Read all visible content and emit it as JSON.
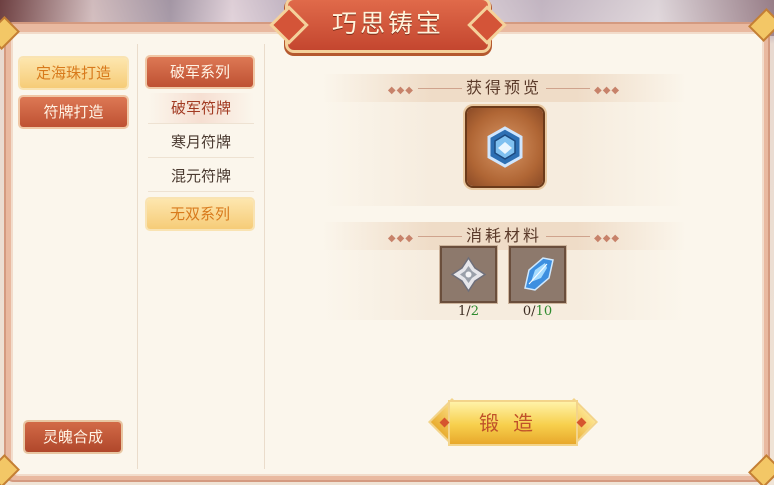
{
  "title": "巧思铸宝",
  "left_tabs": [
    {
      "label": "定海珠打造",
      "active": true
    },
    {
      "label": "符牌打造",
      "active": false
    }
  ],
  "bottom_button": "灵魄合成",
  "series": [
    {
      "label": "破军系列",
      "expanded": true,
      "items": [
        "破军符牌",
        "寒月符牌",
        "混元符牌"
      ],
      "selected_item": "破军符牌"
    },
    {
      "label": "无双系列",
      "expanded": false
    }
  ],
  "preview": {
    "header": "获得预览",
    "item_icon": "blue-hexagon-rune-icon"
  },
  "materials": {
    "header": "消耗材料",
    "items": [
      {
        "icon": "silver-star-rune-icon",
        "have": "1",
        "sep": "/",
        "need": "2"
      },
      {
        "icon": "blue-crystal-shard-icon",
        "have": "0",
        "sep": "/",
        "need": "10"
      }
    ]
  },
  "forge_button": "锻造",
  "colors": {
    "accent": "#c4462f",
    "gold": "#f7cf4c",
    "need_green": "#2e8a2e"
  }
}
